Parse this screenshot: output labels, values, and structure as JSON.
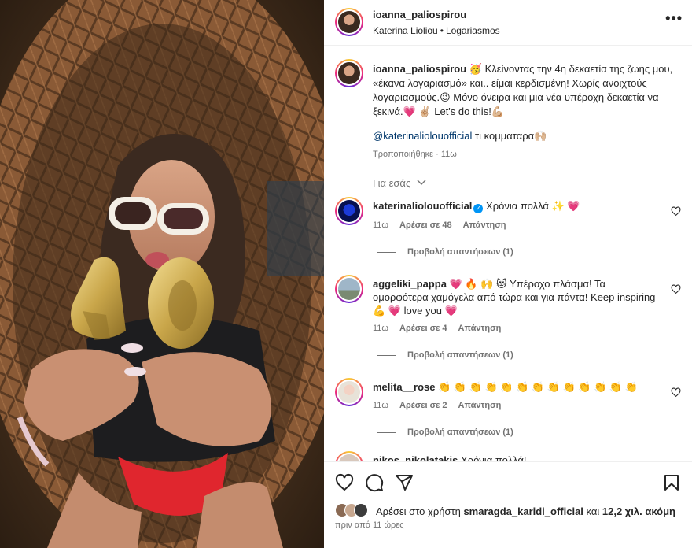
{
  "post": {
    "author": "ioanna_paliospirou",
    "collab": "Katerina Lioliou",
    "audio": "Logariasmos",
    "more_icon": "more-horizontal-icon"
  },
  "caption": {
    "username": "ioanna_paliospirou",
    "text": "🥳 Κλείνοντας την 4η δεκαετία της ζωής μου, «έκανα λογαριασμό» και.. είμαι κερδισμένη! Χωρίς ανοιχτούς λογαριασμούς.😉  Μόνο όνειρα και μια νέα υπέροχη δεκαετία να ξεκινά.💗 ✌🏼 Let's do this!💪🏼",
    "mention": "@katerinaliolouofficial",
    "mention_suffix": " τι κομματαρα🙌🏼",
    "edited": "Τροποποιήθηκε",
    "time": "11ω",
    "for_you": "Για εσάς"
  },
  "comments": [
    {
      "username": "katerinaliolouofficial",
      "verified": true,
      "text": "Χρόνια πολλά ✨ 💗",
      "time": "11ω",
      "likes": "Αρέσει σε 48",
      "reply": "Απάντηση",
      "view_replies": "Προβολή απαντήσεων (1)"
    },
    {
      "username": "aggeliki_pappa",
      "verified": false,
      "text": "💗 🔥 🙌 😻 Υπέροχο πλάσμα! Τα ομορφότερα χαμόγελα από τώρα και για πάντα! Keep inspiring 💪 💗 love you 💗",
      "time": "11ω",
      "likes": "Αρέσει σε 4",
      "reply": "Απάντηση",
      "view_replies": "Προβολή απαντήσεων (1)"
    },
    {
      "username": "melita__rose",
      "verified": false,
      "text": "👏 👏 👏 👏 👏 👏 👏 👏 👏 👏 👏 👏 👏",
      "time": "11ω",
      "likes": "Αρέσει σε 2",
      "reply": "Απάντηση",
      "view_replies": "Προβολή απαντήσεων (1)"
    },
    {
      "username": "nikos_nikolatakis",
      "verified": false,
      "text": "Χρόνια πολλά!"
    }
  ],
  "footer": {
    "likes_prefix": "Αρέσει στο χρήστη ",
    "likes_user": "smaragda_karidi_official",
    "likes_and": " και ",
    "likes_count": "12,2 χιλ. ακόμη",
    "time_ago": "πριν από 11 ώρες",
    "icons": [
      "heart-icon",
      "comment-icon",
      "share-icon",
      "bookmark-icon"
    ]
  },
  "colors": {
    "link": "#00376b",
    "muted": "#737373",
    "verified": "#0095f6",
    "swimsuit": "#e0262e",
    "balloon": "#c9a64a"
  }
}
